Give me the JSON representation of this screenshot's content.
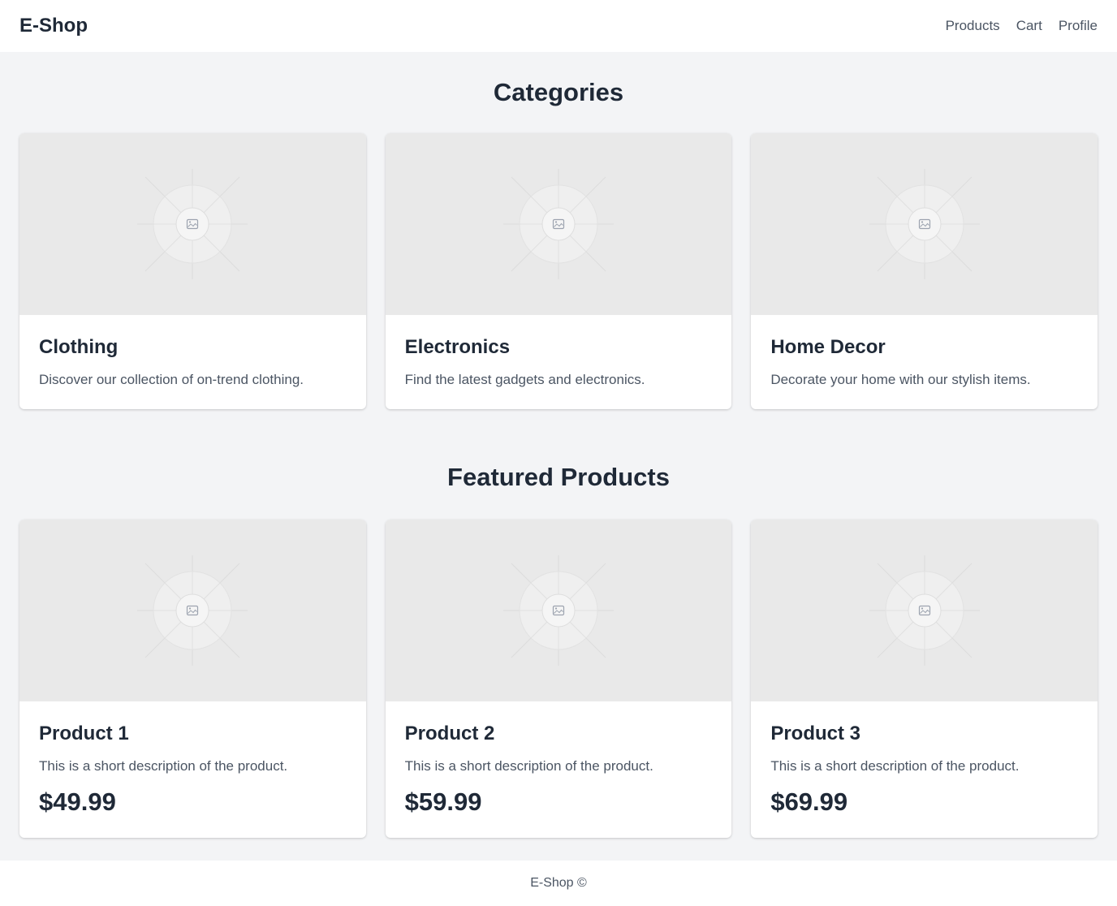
{
  "header": {
    "brand": "E-Shop",
    "nav": [
      {
        "label": "Products"
      },
      {
        "label": "Cart"
      },
      {
        "label": "Profile"
      }
    ]
  },
  "categories": {
    "title": "Categories",
    "items": [
      {
        "name": "Clothing",
        "description": "Discover our collection of on-trend clothing.",
        "image_icon": "image-placeholder-icon"
      },
      {
        "name": "Electronics",
        "description": "Find the latest gadgets and electronics.",
        "image_icon": "image-placeholder-icon"
      },
      {
        "name": "Home Decor",
        "description": "Decorate your home with our stylish items.",
        "image_icon": "image-placeholder-icon"
      }
    ]
  },
  "featured": {
    "title": "Featured Products",
    "items": [
      {
        "name": "Product 1",
        "description": "This is a short description of the product.",
        "price": "$49.99",
        "image_icon": "image-placeholder-icon"
      },
      {
        "name": "Product 2",
        "description": "This is a short description of the product.",
        "price": "$59.99",
        "image_icon": "image-placeholder-icon"
      },
      {
        "name": "Product 3",
        "description": "This is a short description of the product.",
        "price": "$69.99",
        "image_icon": "image-placeholder-icon"
      }
    ]
  },
  "footer": {
    "text": "E-Shop ©"
  },
  "colors": {
    "page_bg": "#f3f4f6",
    "card_bg": "#ffffff",
    "text_primary": "#1f2937",
    "text_secondary": "#4b5563",
    "image_placeholder_bg": "#e9e9e9"
  }
}
